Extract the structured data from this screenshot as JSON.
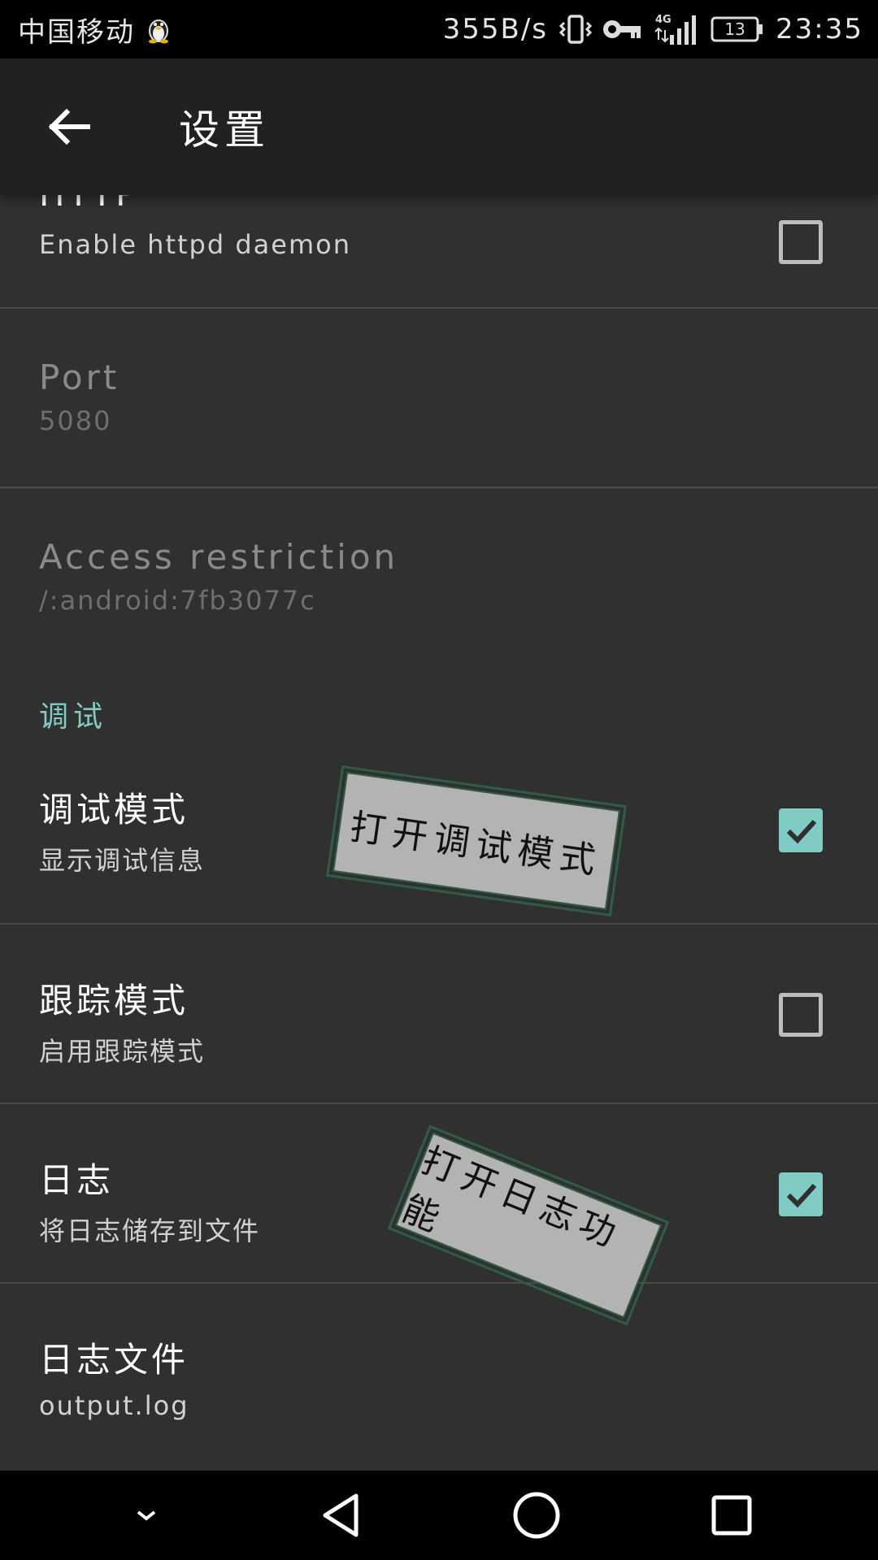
{
  "status_bar": {
    "carrier": "中国移动",
    "speed": "355B/s",
    "network": "4G",
    "battery": "13",
    "time": "23:35"
  },
  "app_bar": {
    "title": "设置"
  },
  "prefs": {
    "http": {
      "title": "HTTP",
      "summary": "Enable httpd daemon",
      "checked": false
    },
    "port": {
      "title": "Port",
      "summary": "5080"
    },
    "access": {
      "title": "Access restriction",
      "summary": "/:android:7fb3077c"
    },
    "debug_category": "调试",
    "debug_mode": {
      "title": "调试模式",
      "summary": "显示调试信息",
      "checked": true
    },
    "trace_mode": {
      "title": "跟踪模式",
      "summary": "启用跟踪模式",
      "checked": false
    },
    "log": {
      "title": "日志",
      "summary": "将日志储存到文件",
      "checked": true
    },
    "log_file": {
      "title": "日志文件",
      "summary": "output.log"
    }
  },
  "annotations": {
    "debug_note": "打开调试模式",
    "log_note": "打开日志功能"
  },
  "colors": {
    "accent": "#80cbc4",
    "background": "#303030",
    "app_bar": "#212121"
  }
}
